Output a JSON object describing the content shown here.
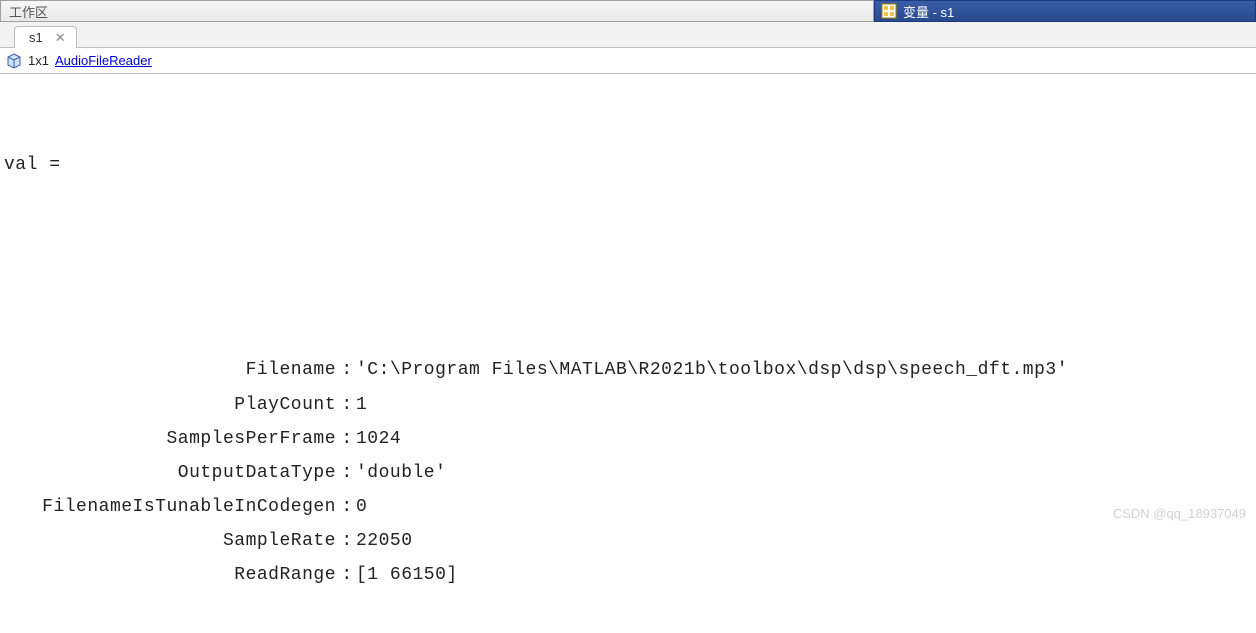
{
  "panels": {
    "workspace_title": "工作区",
    "variables_title": "变量 - s1"
  },
  "tab": {
    "label": "s1",
    "close_glyph": "✕"
  },
  "infobar": {
    "dims": "1x1",
    "type_link": "AudioFileReader"
  },
  "output": {
    "header": "val =",
    "props": [
      {
        "label": "Filename",
        "value": "'C:\\Program Files\\MATLAB\\R2021b\\toolbox\\dsp\\dsp\\speech_dft.mp3'"
      },
      {
        "label": "PlayCount",
        "value": "1"
      },
      {
        "label": "SamplesPerFrame",
        "value": "1024"
      },
      {
        "label": "OutputDataType",
        "value": "'double'"
      },
      {
        "label": "FilenameIsTunableInCodegen",
        "value": "0"
      },
      {
        "label": "SampleRate",
        "value": "22050"
      },
      {
        "label": "ReadRange",
        "value": "[1 66150]"
      }
    ]
  },
  "watermark": "CSDN @qq_18937049"
}
